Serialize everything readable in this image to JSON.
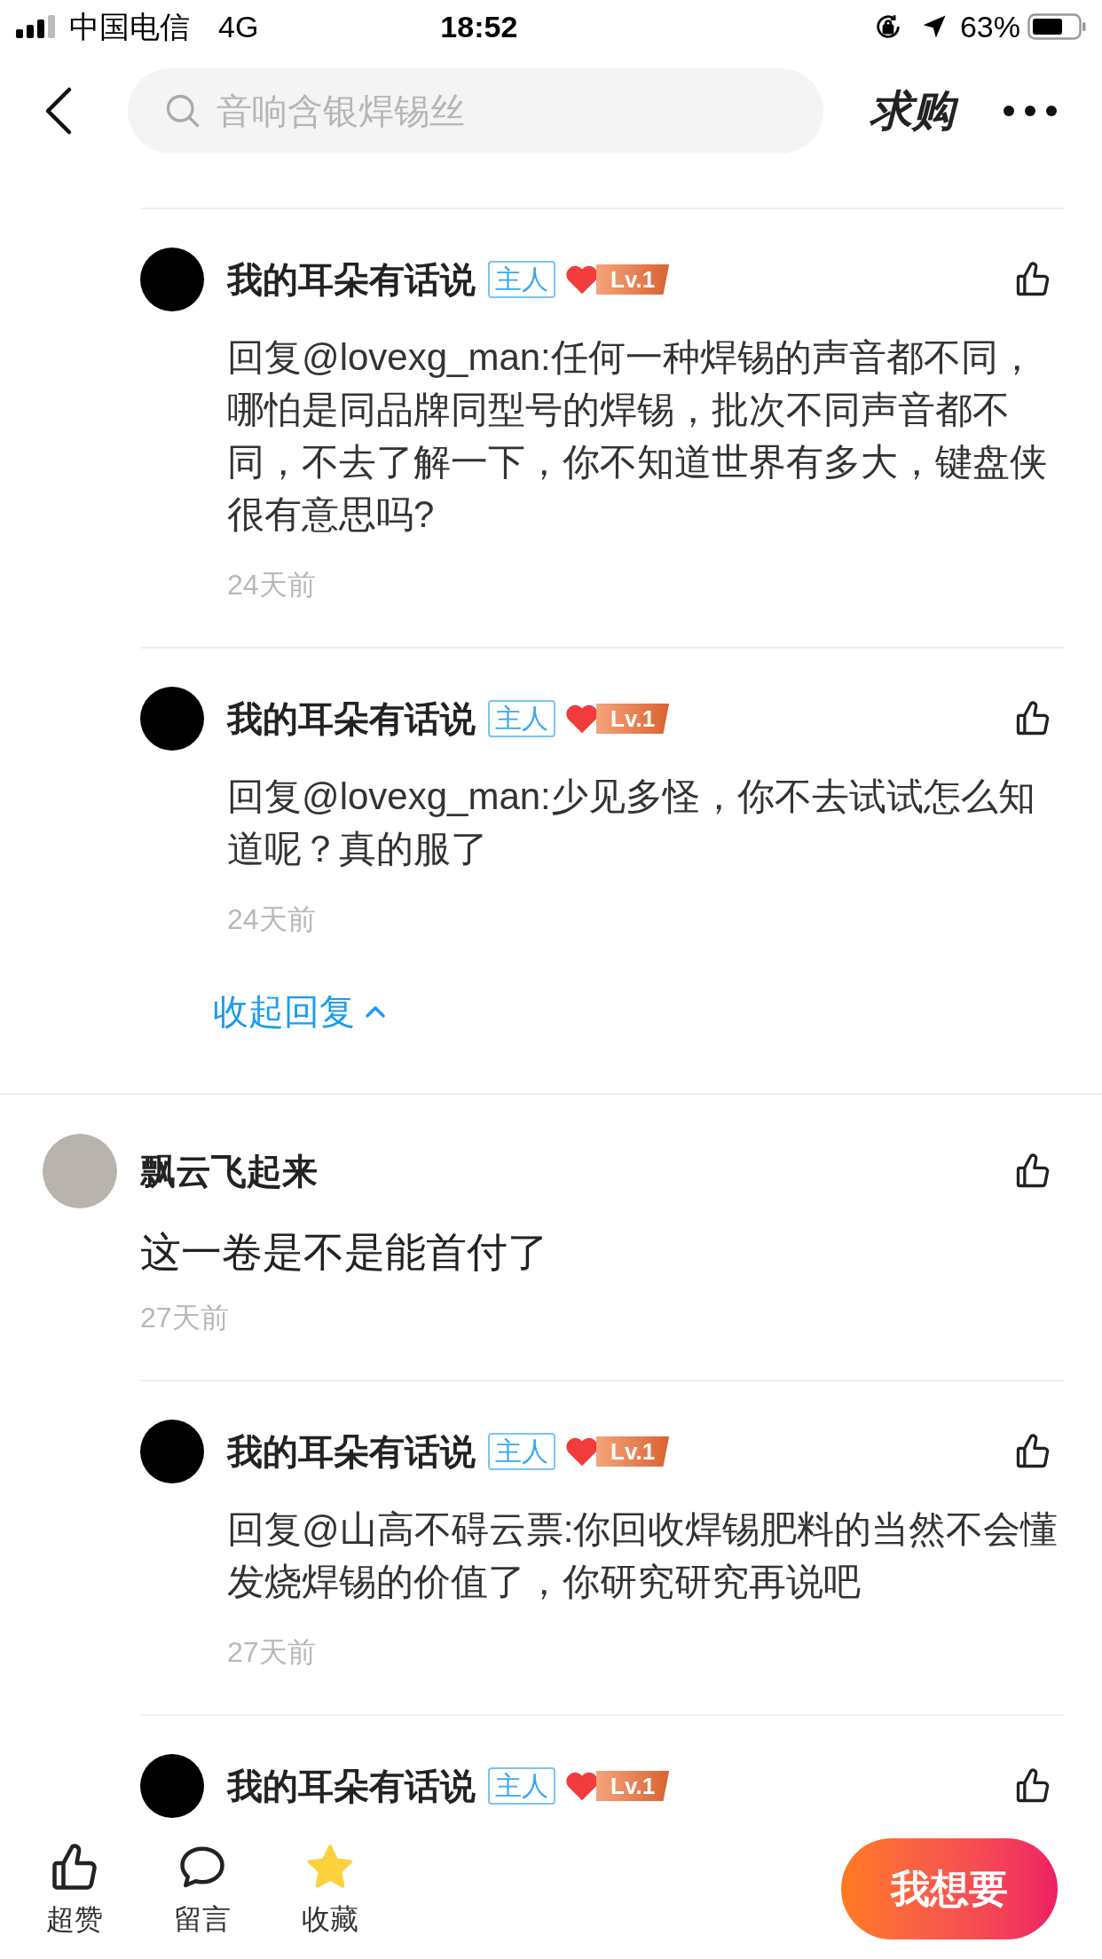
{
  "status_bar": {
    "carrier": "中国电信",
    "network": "4G",
    "time": "18:52",
    "battery": "63%"
  },
  "header": {
    "search": {
      "placeholder": "音响含银焊锡丝"
    },
    "action": "求购"
  },
  "comments": [
    {
      "kind": "reply",
      "name": "我的耳朵有话说",
      "tag": "主人",
      "level_badge": "Lv.1",
      "text": "回复@lovexg_man:任何一种焊锡的声音都不同，哪怕是同品牌同型号的焊锡，批次不同声音都不同，不去了解一下，你不知道世界有多大，键盘侠很有意思吗?",
      "time": "24天前"
    },
    {
      "kind": "reply",
      "name": "我的耳朵有话说",
      "tag": "主人",
      "level_badge": "Lv.1",
      "text": "回复@lovexg_man:少见多怪，你不去试试怎么知道呢？真的服了",
      "time": "24天前"
    },
    {
      "kind": "collapse",
      "label": "收起回复"
    },
    {
      "kind": "comment",
      "name": "飘云飞起来",
      "text": "这一卷是不是能首付了",
      "time": "27天前"
    },
    {
      "kind": "reply",
      "name": "我的耳朵有话说",
      "tag": "主人",
      "level_badge": "Lv.1",
      "text": "回复@山高不碍云票:你回收焊锡肥料的当然不会懂发烧焊锡的价值了，你研究研究再说吧",
      "time": "27天前"
    },
    {
      "kind": "reply",
      "name": "我的耳朵有话说",
      "tag": "主人",
      "level_badge": "Lv.1"
    }
  ],
  "bottom_bar": {
    "actions": [
      {
        "kind": "like",
        "label": "超赞"
      },
      {
        "kind": "comment",
        "label": "留言"
      },
      {
        "kind": "favorite",
        "label": "收藏"
      }
    ],
    "button": "我想要"
  }
}
